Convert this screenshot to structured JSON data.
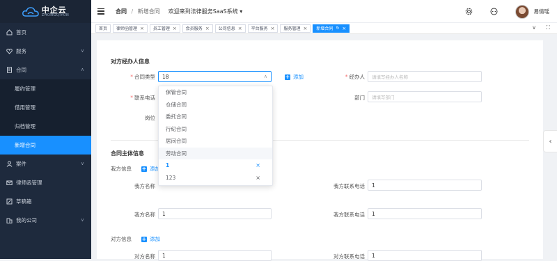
{
  "logo": {
    "cn": "中企云",
    "en": "ZHONGQIYUN"
  },
  "sidebar": {
    "items": [
      {
        "label": "首页",
        "icon": "home-icon"
      },
      {
        "label": "服务",
        "icon": "heart-icon",
        "arrow": "∨"
      },
      {
        "label": "合同",
        "icon": "document-icon",
        "arrow": "∧"
      }
    ],
    "sub_items": [
      {
        "label": "履约管理"
      },
      {
        "label": "借用管理"
      },
      {
        "label": "归档管理"
      },
      {
        "label": "新增合同"
      }
    ],
    "items2": [
      {
        "label": "案件",
        "icon": "person-icon",
        "arrow": "∨"
      },
      {
        "label": "律师函管理",
        "icon": "mail-icon"
      },
      {
        "label": "草稿箱",
        "icon": "draft-icon"
      },
      {
        "label": "我的公司",
        "icon": "company-icon",
        "arrow": "∨"
      }
    ]
  },
  "header": {
    "crumb_root": "合同",
    "crumb_sep": "/",
    "crumb_current": "新增合同",
    "welcome": "欢迎来到法律服务SaaS系统 ▾",
    "username": "易倩瑶"
  },
  "tags": [
    {
      "label": "首页",
      "close": ""
    },
    {
      "label": "律师函管理",
      "close": "×"
    },
    {
      "label": "员工管理",
      "close": "×"
    },
    {
      "label": "会员服务",
      "close": "×"
    },
    {
      "label": "公司信息",
      "close": "×"
    },
    {
      "label": "平台服务",
      "close": "×"
    },
    {
      "label": "服务管理",
      "close": "×"
    },
    {
      "label": "新增合同",
      "close": "×",
      "refresh": "↻"
    }
  ],
  "tagbar_controls": {
    "collapse": "∨",
    "fullscreen": "⛶"
  },
  "form": {
    "section1_title": "对方经办人信息",
    "contract_type_label": "合同类型",
    "contract_type_value": "18",
    "add_label": "添加",
    "handler_label": "经办人",
    "handler_placeholder": "请填写经办人名称",
    "phone_label": "联系电话",
    "dept_label": "部门",
    "dept_placeholder": "请填写部门",
    "position_label": "岗位",
    "required_mark": "*",
    "section2_title": "合同主体信息",
    "our_info_label": "我方信息",
    "our_name_label": "我方名称",
    "our_phone_label": "我方联系电话",
    "our_phone_value_1": "1",
    "our_name_value_2": "1",
    "our_phone_value_2": "1",
    "other_info_label": "对方信息",
    "other_name_label": "对方名称",
    "other_name_value": "1",
    "other_phone_label": "对方联系电话",
    "other_phone_value": "1"
  },
  "dropdown": {
    "options": [
      {
        "label": "保管合同",
        "close": ""
      },
      {
        "label": "仓储合同",
        "close": ""
      },
      {
        "label": "委托合同",
        "close": ""
      },
      {
        "label": "行纪合同",
        "close": ""
      },
      {
        "label": "居间合同",
        "close": ""
      },
      {
        "label": "劳动合同",
        "close": ""
      },
      {
        "label": "1",
        "close": "×"
      },
      {
        "label": "123",
        "close": "×"
      }
    ]
  },
  "right_tab_icon": "‹",
  "colors": {
    "primary": "#1890ff",
    "sidebar_bg": "#1e2a3d",
    "active_menu": "#1890ff"
  }
}
